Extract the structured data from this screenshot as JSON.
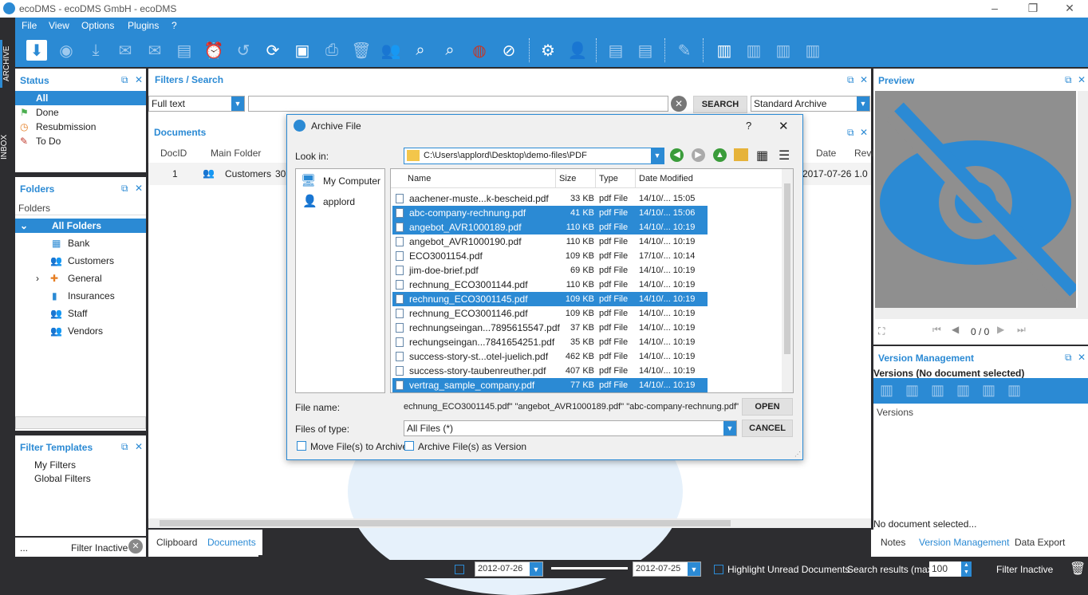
{
  "window": {
    "title": "ecoDMS - ecoDMS GmbH - ecoDMS",
    "controls": [
      "–",
      "❐",
      "✕"
    ]
  },
  "menu": [
    "File",
    "View",
    "Options",
    "Plugins",
    "?"
  ],
  "sidetabs": [
    "ARCHIVE",
    "INBOX"
  ],
  "status": {
    "title": "Status",
    "items": [
      "All",
      "Done",
      "Resubmission",
      "To Do"
    ]
  },
  "folders": {
    "title": "Folders",
    "header": "Folders",
    "items": [
      "All Folders",
      "Bank",
      "Customers",
      "General",
      "Insurances",
      "Staff",
      "Vendors"
    ]
  },
  "filter_templates": {
    "title": "Filter Templates",
    "items": [
      "My Filters",
      "Global Filters"
    ]
  },
  "left_footer": {
    "dots": "...",
    "filter": "Filter Inactive"
  },
  "filters": {
    "title": "Filters / Search",
    "mode": "Full text",
    "search_button": "SEARCH",
    "archive": "Standard Archive"
  },
  "documents": {
    "title": "Documents",
    "columns": [
      "DocID",
      "Main Folder",
      "Date",
      "Revi"
    ],
    "row": {
      "id": "1",
      "folder": "Customers",
      "partial": "30",
      "date": "2017-07-26",
      "rev": "1.0"
    }
  },
  "center_tabs": [
    "Clipboard",
    "Documents"
  ],
  "preview": {
    "title": "Preview",
    "page": "0 / 0"
  },
  "versions": {
    "title": "Version Management",
    "subtitle": "Versions (No document selected)",
    "label": "Versions",
    "status": "No document selected..."
  },
  "right_tabs": [
    "Notes",
    "Version Management",
    "Data Export"
  ],
  "statusbar": {
    "date_from": "2012-07-26",
    "date_to": "2012-07-25",
    "highlight": "Highlight Unread Documents",
    "results_label": "Search results (max)",
    "results": "100",
    "filter": "Filter Inactive"
  },
  "dialog": {
    "title": "Archive File",
    "help": "?",
    "close": "✕",
    "look_in_label": "Look in:",
    "path": "C:\\Users\\applord\\Desktop\\demo-files\\PDF",
    "places": [
      "My Computer",
      "applord"
    ],
    "columns": [
      "Name",
      "Size",
      "Type",
      "Date Modified"
    ],
    "files": [
      {
        "name": "aachener-muste...k-bescheid.pdf",
        "size": "33 KB",
        "type": "pdf File",
        "date": "14/10/... 15:05",
        "selected": false
      },
      {
        "name": "abc-company-rechnung.pdf",
        "size": "41 KB",
        "type": "pdf File",
        "date": "14/10/... 15:06",
        "selected": true
      },
      {
        "name": "angebot_AVR1000189.pdf",
        "size": "110 KB",
        "type": "pdf File",
        "date": "14/10/... 10:19",
        "selected": true
      },
      {
        "name": "angebot_AVR1000190.pdf",
        "size": "110 KB",
        "type": "pdf File",
        "date": "14/10/... 10:19",
        "selected": false
      },
      {
        "name": "ECO3001154.pdf",
        "size": "109 KB",
        "type": "pdf File",
        "date": "17/10/... 10:14",
        "selected": false
      },
      {
        "name": "jim-doe-brief.pdf",
        "size": "69 KB",
        "type": "pdf File",
        "date": "14/10/... 10:19",
        "selected": false
      },
      {
        "name": "rechnung_ECO3001144.pdf",
        "size": "110 KB",
        "type": "pdf File",
        "date": "14/10/... 10:19",
        "selected": false
      },
      {
        "name": "rechnung_ECO3001145.pdf",
        "size": "109 KB",
        "type": "pdf File",
        "date": "14/10/... 10:19",
        "selected": true
      },
      {
        "name": "rechnung_ECO3001146.pdf",
        "size": "109 KB",
        "type": "pdf File",
        "date": "14/10/... 10:19",
        "selected": false
      },
      {
        "name": "rechnungseingan...7895615547.pdf",
        "size": "37 KB",
        "type": "pdf File",
        "date": "14/10/... 10:19",
        "selected": false
      },
      {
        "name": "rechungseingan...7841654251.pdf",
        "size": "35 KB",
        "type": "pdf File",
        "date": "14/10/... 10:19",
        "selected": false
      },
      {
        "name": "success-story-st...otel-juelich.pdf",
        "size": "462 KB",
        "type": "pdf File",
        "date": "14/10/... 10:19",
        "selected": false
      },
      {
        "name": "success-story-taubenreuther.pdf",
        "size": "407 KB",
        "type": "pdf File",
        "date": "14/10/... 10:19",
        "selected": false
      },
      {
        "name": "vertrag_sample_company.pdf",
        "size": "77 KB",
        "type": "pdf File",
        "date": "14/10/... 10:19",
        "selected": true
      }
    ],
    "filename_label": "File name:",
    "filename": "echnung_ECO3001145.pdf\" \"angebot_AVR1000189.pdf\" \"abc-company-rechnung.pdf\"",
    "filetype_label": "Files of type:",
    "filetype": "All Files (*)",
    "open": "OPEN",
    "cancel": "CANCEL",
    "move_label": "Move File(s) to Archive",
    "version_label": "Archive File(s) as Version"
  }
}
